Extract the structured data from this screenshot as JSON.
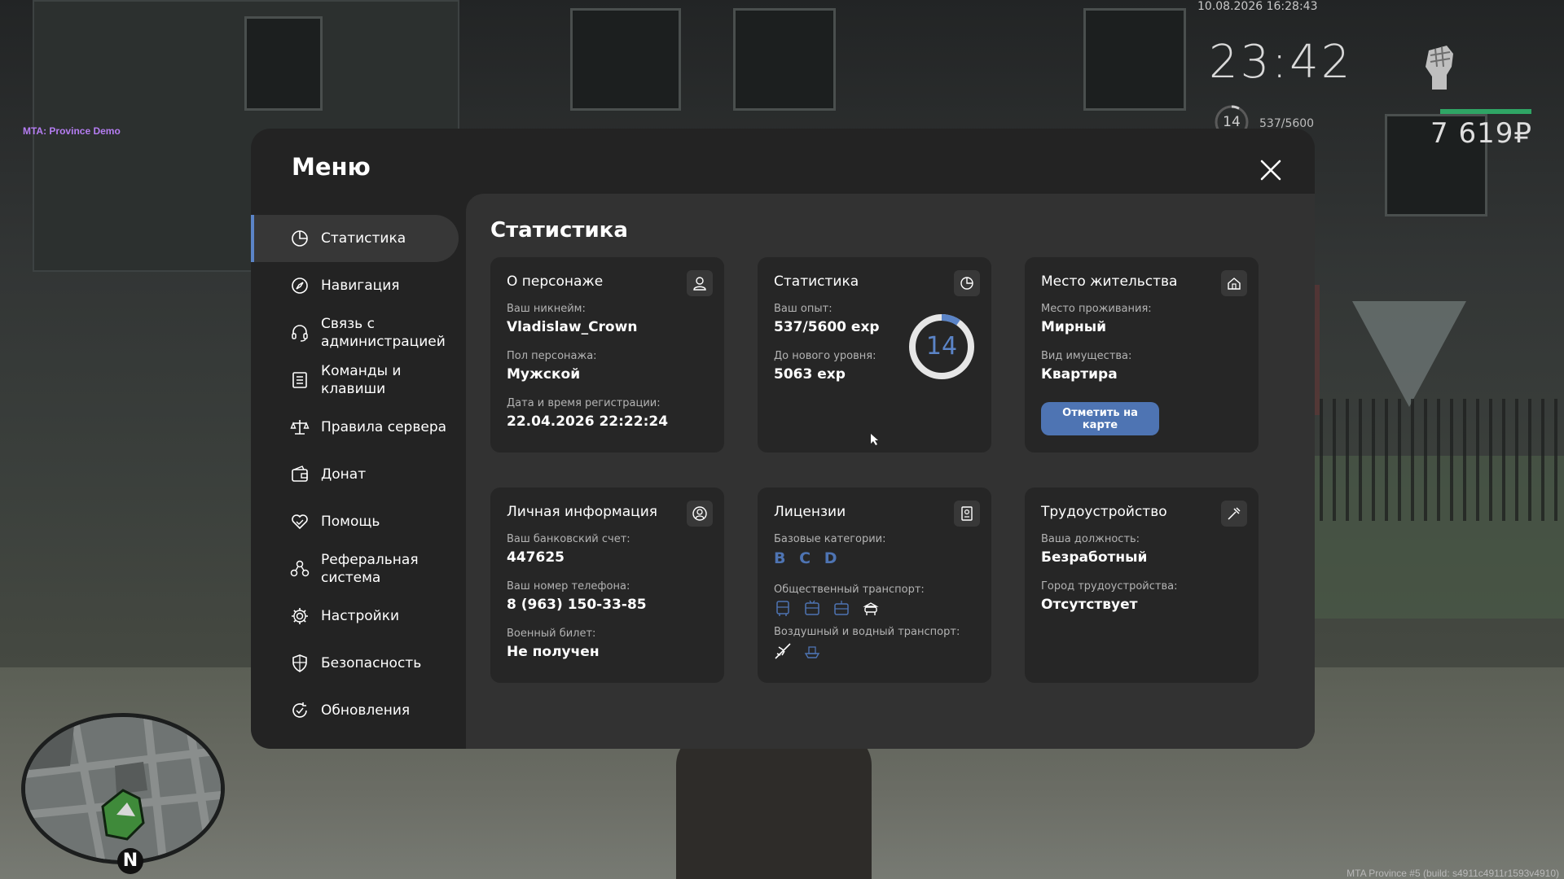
{
  "hud": {
    "server_label": "MTA: Province Demo",
    "datetime": "10.08.2026 16:28:43",
    "clock": "23:42",
    "level": "14",
    "exp": "537/5600",
    "money": "7 619₽",
    "build": "MTA Province #5 (build: s4911c4911r1593v4910)",
    "north": "N"
  },
  "menu": {
    "title": "Меню",
    "close_icon": "close-icon",
    "nav": [
      {
        "label": "Статистика",
        "icon": "pie-chart-icon",
        "active": true
      },
      {
        "label": "Навигация",
        "icon": "compass-icon"
      },
      {
        "label": "Связь с\nадминистрацией",
        "icon": "headset-icon"
      },
      {
        "label": "Команды и\nклавиши",
        "icon": "document-list-icon"
      },
      {
        "label": "Правила сервера",
        "icon": "scales-icon"
      },
      {
        "label": "Донат",
        "icon": "wallet-icon"
      },
      {
        "label": "Помощь",
        "icon": "heart-hands-icon"
      },
      {
        "label": "Реферальная\nсистема",
        "icon": "referral-icon"
      },
      {
        "label": "Настройки",
        "icon": "gear-icon"
      },
      {
        "label": "Безопасность",
        "icon": "shield-icon"
      },
      {
        "label": "Обновления",
        "icon": "refresh-check-icon"
      }
    ]
  },
  "content": {
    "title": "Статистика",
    "character": {
      "title": "О персонаже",
      "nickname_label": "Ваш никнейм:",
      "nickname": "Vladislaw_Crown",
      "gender_label": "Пол персонажа:",
      "gender": "Мужской",
      "reg_label": "Дата и время регистрации:",
      "reg_date": "22.04.2026 22:22:24"
    },
    "stats": {
      "title": "Статистика",
      "exp_label": "Ваш опыт:",
      "exp": "537/5600 exp",
      "next_label": "До нового уровня:",
      "next": "5063 exp",
      "level": "14",
      "progress": 0.096
    },
    "residence": {
      "title": "Место жительства",
      "place_label": "Место проживания:",
      "place": "Мирный",
      "property_label": "Вид имущества:",
      "property": "Квартира",
      "button": "Отметить на карте"
    },
    "personal": {
      "title": "Личная информация",
      "bank_label": "Ваш банковский счет:",
      "bank": "447625",
      "phone_label": "Ваш номер телефона:",
      "phone": "8 (963) 150-33-85",
      "military_label": "Военный билет:",
      "military": "Не получен"
    },
    "licenses": {
      "title": "Лицензии",
      "base_label": "Базовые категории:",
      "categories": [
        "B",
        "C",
        "D"
      ],
      "public_label": "Общественный транспорт:",
      "public_icons": [
        "bus-icon",
        "trolleybus-icon",
        "tram-icon",
        "taxi-icon"
      ],
      "air_label": "Воздушный и водный транспорт:",
      "air_icons": [
        "plane-icon",
        "boat-icon"
      ]
    },
    "employment": {
      "title": "Трудоустройство",
      "position_label": "Ваша должность:",
      "position": "Безработный",
      "city_label": "Город трудоустройства:",
      "city": "Отсутствует"
    }
  },
  "colors": {
    "accent": "#5b84c7",
    "button": "#4e74b3",
    "hud_bar": "#2fa565",
    "server_label": "#b57df2"
  }
}
